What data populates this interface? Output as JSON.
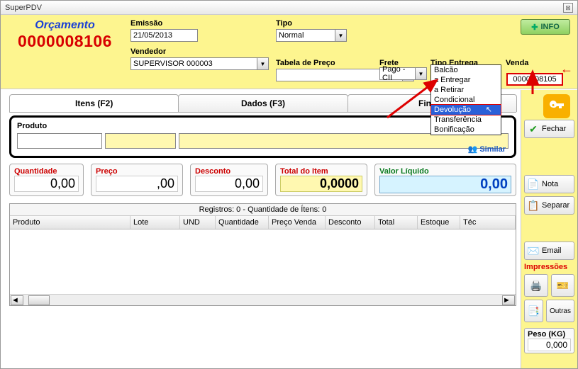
{
  "window": {
    "title": "SuperPDV"
  },
  "header": {
    "orc_label": "Orçamento",
    "orc_number": "0000008106",
    "emissao_label": "Emissão",
    "emissao_value": "21/05/2013",
    "vendedor_label": "Vendedor",
    "vendedor_value": "SUPERVISOR   000003",
    "tipo_label": "Tipo",
    "tipo_value": "Normal",
    "tabela_label": "Tabela de Preço",
    "tabela_value": "",
    "frete_label": "Frete",
    "frete_value": "Pago - CII",
    "entrega_label": "Tipo Entrega",
    "entrega_value": "Devolução",
    "venda_label": "Venda",
    "venda_value": "0000008105",
    "info_btn": "INFO"
  },
  "entrega_options": [
    "Balcão",
    "a Entregar",
    "a Retirar",
    "Condicional",
    "Devolução",
    "Transferência",
    "Bonificação"
  ],
  "entrega_selected_index": 4,
  "tabs": {
    "itens": "Itens (F2)",
    "dados": "Dados (F3)",
    "financ": "Financ"
  },
  "produto": {
    "label": "Produto",
    "similar": "Similar"
  },
  "values": {
    "qtd_label": "Quantidade",
    "qtd": "0,00",
    "preco_label": "Preço",
    "preco": ",00",
    "desc_label": "Desconto",
    "desc": "0,00",
    "total_label": "Total do Item",
    "total": "0,0000",
    "liq_label": "Valor Líquido",
    "liq": "0,00"
  },
  "grid": {
    "status": "Registros: 0  -  Quantidade de Ítens: 0",
    "cols": [
      "Produto",
      "Lote",
      "UND",
      "Quantidade",
      "Preço Venda",
      "Desconto",
      "Total",
      "Estoque",
      "Téc"
    ]
  },
  "side": {
    "fechar": "Fechar",
    "nota": "Nota",
    "separar": "Separar",
    "email": "Email",
    "impressoes": "Impressões",
    "outras": "Outras",
    "peso_label": "Peso (KG)",
    "peso": "0,000"
  }
}
